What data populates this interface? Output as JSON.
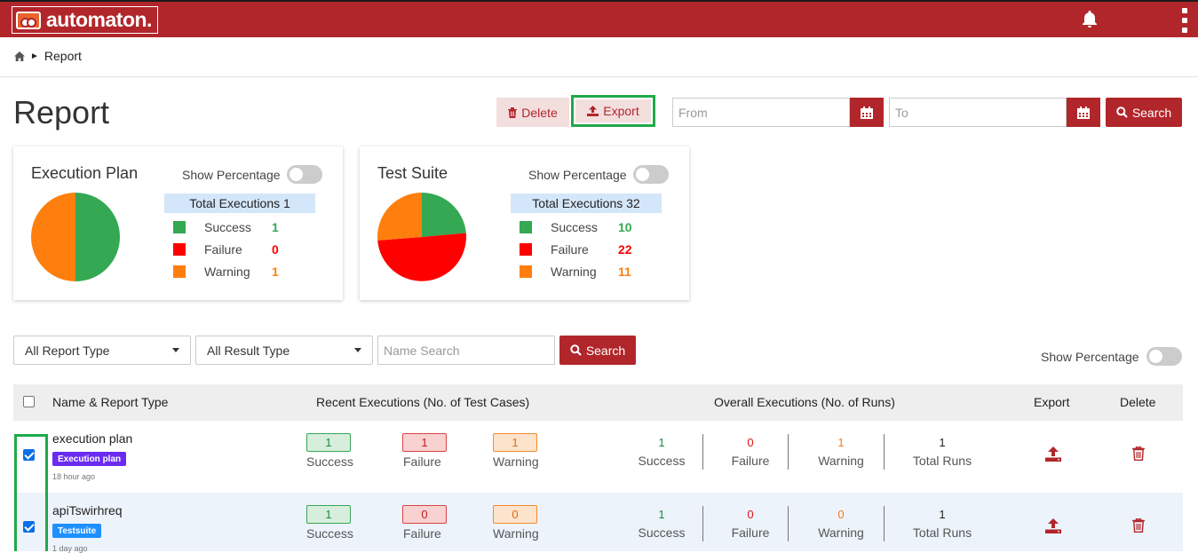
{
  "app": {
    "name": "automaton."
  },
  "header": {
    "bell_icon": "bell-icon",
    "menu_icon": "kebab-menu-icon"
  },
  "breadcrumb": {
    "home_icon": "home-icon",
    "current": "Report"
  },
  "page": {
    "title": "Report"
  },
  "toolbar": {
    "delete_label": "Delete",
    "export_label": "Export",
    "from_placeholder": "From",
    "to_placeholder": "To",
    "search_label": "Search"
  },
  "cards": [
    {
      "title": "Execution Plan",
      "show_percentage_label": "Show Percentage",
      "total_label": "Total Executions 1",
      "legend": [
        {
          "label": "Success",
          "value": "1",
          "color": "#34a853"
        },
        {
          "label": "Failure",
          "value": "0",
          "color": "#ff0000"
        },
        {
          "label": "Warning",
          "value": "1",
          "color": "#ff7f0e"
        }
      ]
    },
    {
      "title": "Test Suite",
      "show_percentage_label": "Show Percentage",
      "total_label": "Total Executions 32",
      "legend": [
        {
          "label": "Success",
          "value": "10",
          "color": "#34a853"
        },
        {
          "label": "Failure",
          "value": "22",
          "color": "#ff0000"
        },
        {
          "label": "Warning",
          "value": "11",
          "color": "#ff7f0e"
        }
      ]
    }
  ],
  "filters": {
    "report_type": "All Report Type",
    "result_type": "All Result Type",
    "name_search_placeholder": "Name Search",
    "search_label": "Search",
    "show_percentage_label": "Show Percentage"
  },
  "table": {
    "headers": {
      "name": "Name & Report Type",
      "recent": "Recent Executions (No. of Test Cases)",
      "overall": "Overall Executions (No. of Runs)",
      "export": "Export",
      "delete": "Delete"
    },
    "rows": [
      {
        "name": "execution plan",
        "type": "Execution plan",
        "type_color": "#6a2cf0",
        "ago": "18 hour ago",
        "checked": true,
        "recent": {
          "success": "1",
          "failure": "1",
          "warning": "1",
          "success_label": "Success",
          "failure_label": "Failure",
          "warning_label": "Warning"
        },
        "overall": {
          "success": "1",
          "failure": "0",
          "warning": "1",
          "total": "1",
          "success_label": "Success",
          "failure_label": "Failure",
          "warning_label": "Warning",
          "total_label": "Total Runs"
        }
      },
      {
        "name": "apiTswirhreq",
        "type": "Testsuite",
        "type_color": "#1e90ff",
        "ago": "1 day ago",
        "checked": true,
        "recent": {
          "success": "1",
          "failure": "0",
          "warning": "0",
          "success_label": "Success",
          "failure_label": "Failure",
          "warning_label": "Warning"
        },
        "overall": {
          "success": "1",
          "failure": "0",
          "warning": "0",
          "total": "1",
          "success_label": "Success",
          "failure_label": "Failure",
          "warning_label": "Warning",
          "total_label": "Total Runs"
        }
      }
    ]
  }
}
